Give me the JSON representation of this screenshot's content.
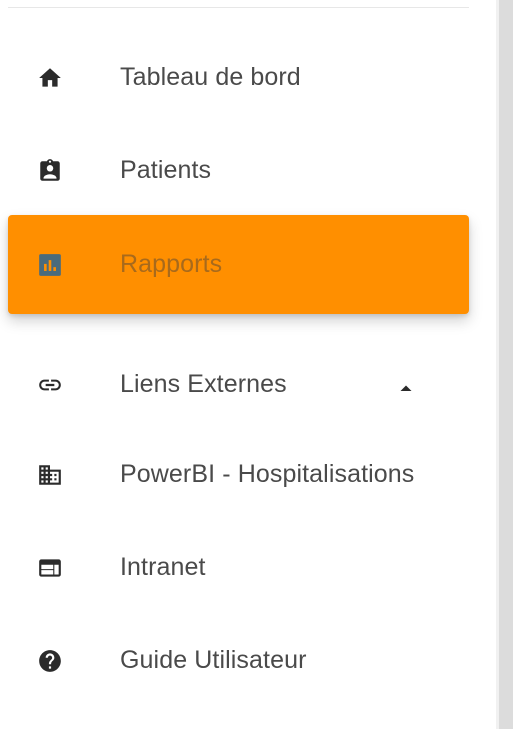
{
  "colors": {
    "active_bg": "#ff8f00",
    "active_text": "#a86a1c",
    "active_icon": "#4a6b7c",
    "icon": "#2b2b2b",
    "text": "#4a4a4a"
  },
  "sidebar": {
    "items": [
      {
        "label": "Tableau de bord",
        "icon": "home-icon",
        "active": false
      },
      {
        "label": "Patients",
        "icon": "badge-icon",
        "active": false
      },
      {
        "label": "Rapports",
        "icon": "bar-chart-icon",
        "active": true
      },
      {
        "label": "Liens Externes",
        "icon": "link-icon",
        "active": false,
        "expandable": true,
        "expanded": true,
        "expand_icon": "caret-up-icon"
      },
      {
        "label": "PowerBI - Hospitalisations",
        "icon": "building-icon",
        "active": false
      },
      {
        "label": "Intranet",
        "icon": "web-window-icon",
        "active": false
      },
      {
        "label": "Guide Utilisateur",
        "icon": "help-icon",
        "active": false
      }
    ]
  }
}
